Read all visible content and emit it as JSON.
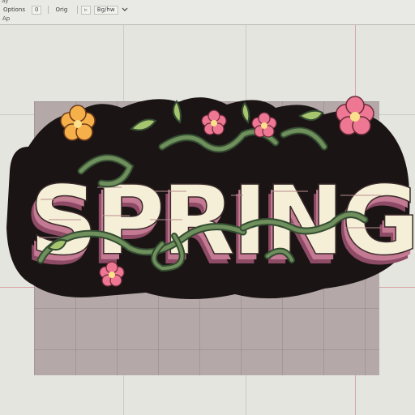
{
  "toolbar": {
    "menu_stub": "ay",
    "options_label": "Options",
    "aspect_label": "0",
    "orig_label": "Orig",
    "arrow_label": "▹",
    "bg_label": "Bg/hw",
    "dropdown_icon": "chevron-down-icon",
    "mode_label": "Ap"
  },
  "artwork": {
    "word": "SPRING",
    "colors": {
      "outline": "#1a1414",
      "letter_face": "#f6efd8",
      "letter_side": "#c47a93",
      "letter_shadow": "#8d4b65",
      "vine": "#5d7a4d",
      "vine_dark": "#334c31",
      "petal_pink": "#ee7893",
      "petal_orange": "#f6b04a",
      "flower_center": "#f9e08a",
      "leaf": "#a6c56e"
    }
  }
}
